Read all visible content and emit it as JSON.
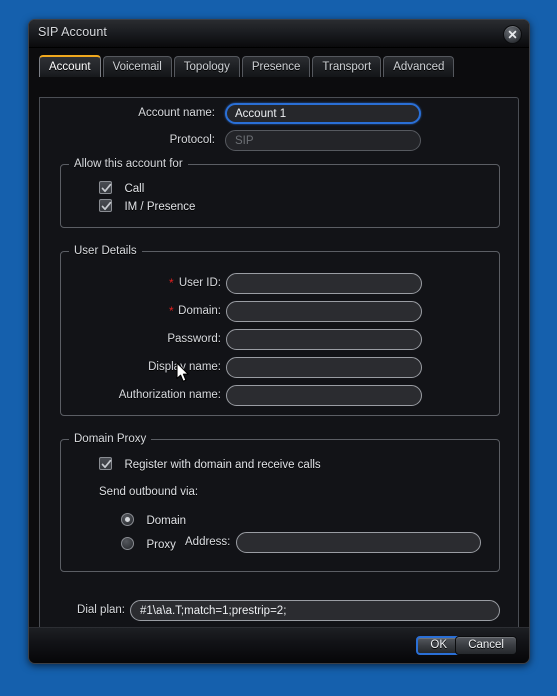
{
  "window": {
    "title": "SIP Account",
    "close_icon": "close-icon"
  },
  "tabs": [
    {
      "label": "Account",
      "active": true
    },
    {
      "label": "Voicemail",
      "active": false
    },
    {
      "label": "Topology",
      "active": false
    },
    {
      "label": "Presence",
      "active": false
    },
    {
      "label": "Transport",
      "active": false
    },
    {
      "label": "Advanced",
      "active": false
    }
  ],
  "account": {
    "name_label": "Account name:",
    "name_value": "Account 1",
    "protocol_label": "Protocol:",
    "protocol_value": "SIP"
  },
  "allow_group": {
    "title": "Allow this account for",
    "items": [
      {
        "label": "Call",
        "checked": true
      },
      {
        "label": "IM / Presence",
        "checked": true
      }
    ]
  },
  "user_details": {
    "title": "User Details",
    "fields": [
      {
        "label": "User ID:",
        "value": "",
        "required": true
      },
      {
        "label": "Domain:",
        "value": "",
        "required": true
      },
      {
        "label": "Password:",
        "value": "",
        "required": false
      },
      {
        "label": "Display name:",
        "value": "",
        "required": false
      },
      {
        "label": "Authorization name:",
        "value": "",
        "required": false
      }
    ]
  },
  "domain_proxy": {
    "title": "Domain Proxy",
    "register_label": "Register with domain and receive calls",
    "register_checked": true,
    "send_outbound_label": "Send outbound via:",
    "options": [
      {
        "label": "Domain",
        "selected": true
      },
      {
        "label": "Proxy",
        "selected": false
      }
    ],
    "address_label": "Address:",
    "address_value": ""
  },
  "dial_plan": {
    "label": "Dial plan:",
    "value": "#1\\a\\a.T;match=1;prestrip=2;"
  },
  "footer": {
    "ok_label": "OK",
    "cancel_label": "Cancel"
  },
  "colors": {
    "desktop": "#1560ad",
    "accent_tab": "#f0a81e",
    "focus_blue": "#2a6fd6",
    "required_red": "#e02020"
  }
}
